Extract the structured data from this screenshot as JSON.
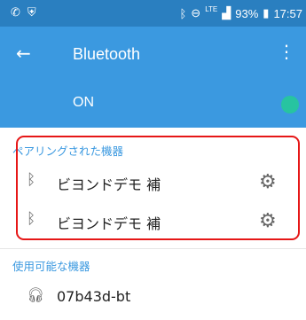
{
  "status_bar": {
    "bluetooth_icon": "bluetooth-icon",
    "lte": "LTE",
    "battery": "93%",
    "time": "17:57"
  },
  "app_bar": {
    "title": "Bluetooth",
    "back_icon": "arrow-left-icon",
    "menu_icon": "more-vert-icon"
  },
  "toggle": {
    "label": "ON",
    "state": "on",
    "accent": "#27c4a0"
  },
  "paired": {
    "header": "ペアリングされた機器",
    "devices": [
      {
        "name": "ビヨンドデモ 補"
      },
      {
        "name": "ビヨンドデモ 補"
      }
    ]
  },
  "available": {
    "header": "使用可能な機器",
    "devices": [
      {
        "name": "07b43d-bt"
      }
    ]
  },
  "colors": {
    "status_bar": "#2a7fc0",
    "app_bar": "#3b99e0",
    "highlight": "#e61717"
  }
}
